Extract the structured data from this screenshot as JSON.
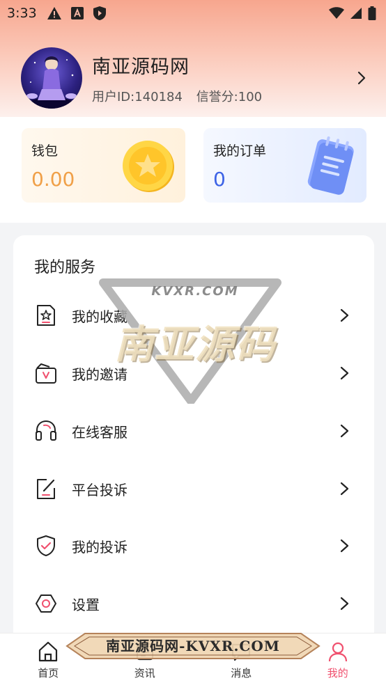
{
  "status_bar": {
    "time": "3:33",
    "left_icons": [
      "warning-icon",
      "font-a-icon",
      "shield-icon"
    ],
    "right_icons": [
      "wifi-icon",
      "signal-icon",
      "battery-icon"
    ]
  },
  "profile": {
    "name": "南亚源码网",
    "user_id": "用户ID:140184",
    "credit": "信誉分:100"
  },
  "wallet": {
    "title": "钱包",
    "value": "0.00",
    "color": "#f0a048"
  },
  "orders": {
    "title": "我的订单",
    "value": "0",
    "color": "#3d63e6"
  },
  "services": {
    "title": "我的服务",
    "items": [
      {
        "label": "我的收藏",
        "icon": "star-badge-icon"
      },
      {
        "label": "我的邀请",
        "icon": "invite-folder-icon"
      },
      {
        "label": "在线客服",
        "icon": "headset-icon"
      },
      {
        "label": "平台投诉",
        "icon": "edit-note-icon"
      },
      {
        "label": "我的投诉",
        "icon": "shield-check-icon"
      },
      {
        "label": "设置",
        "icon": "settings-hex-icon"
      }
    ]
  },
  "tabbar": {
    "tabs": [
      {
        "label": "首页",
        "icon": "home-icon"
      },
      {
        "label": "资讯",
        "icon": "news-icon"
      },
      {
        "label": "消息",
        "icon": "message-icon"
      },
      {
        "label": "我的",
        "icon": "user-icon"
      }
    ],
    "active_color": "#f0506e"
  },
  "watermark": {
    "center_big": "南亚源码",
    "center_small": "KVXR.COM",
    "bottom": "南亚源码网-KVXR.COM"
  }
}
